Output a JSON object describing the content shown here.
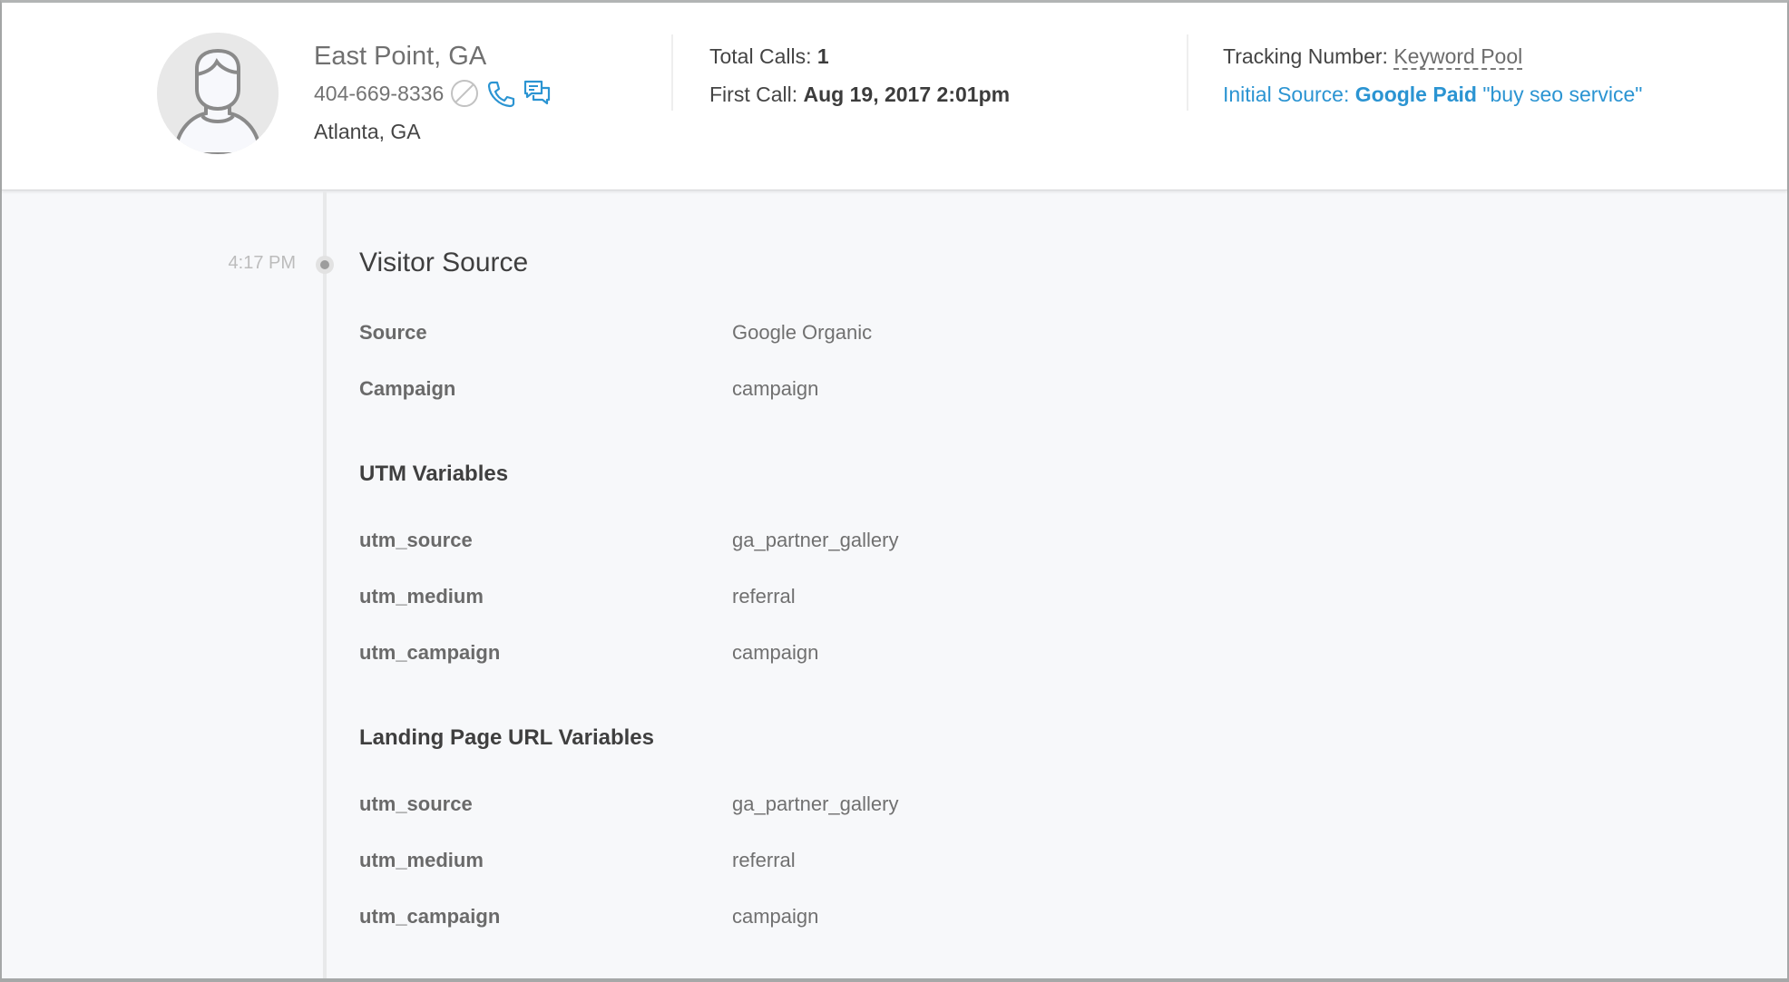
{
  "header": {
    "caller": {
      "city": "East Point, GA",
      "phone": "404-669-8336",
      "location": "Atlanta, GA",
      "icons": [
        "block-icon",
        "phone-icon",
        "chat-icon"
      ]
    },
    "stats": {
      "total_calls_label": "Total Calls:",
      "total_calls_value": "1",
      "first_call_label": "First Call:",
      "first_call_value": "Aug 19, 2017 2:01pm"
    },
    "tracking": {
      "tracking_label": "Tracking Number:",
      "tracking_value": "Keyword Pool",
      "initial_source_label": "Initial Source:",
      "initial_source_name": "Google Paid",
      "initial_source_keyword": "\"buy seo service\""
    }
  },
  "colors": {
    "accent": "#2b94d2",
    "background": "#f7f8fa",
    "header_bg": "#ffffff"
  },
  "timeline": {
    "time": "4:17 PM",
    "title": "Visitor Source",
    "fields": [
      {
        "label": "Source",
        "value": "Google Organic"
      },
      {
        "label": "Campaign",
        "value": "campaign"
      }
    ],
    "utm": {
      "heading": "UTM Variables",
      "rows": [
        {
          "label": "utm_source",
          "value": "ga_partner_gallery"
        },
        {
          "label": "utm_medium",
          "value": "referral"
        },
        {
          "label": "utm_campaign",
          "value": "campaign"
        }
      ]
    },
    "landing": {
      "heading": "Landing Page URL Variables",
      "rows": [
        {
          "label": "utm_source",
          "value": "ga_partner_gallery"
        },
        {
          "label": "utm_medium",
          "value": "referral"
        },
        {
          "label": "utm_campaign",
          "value": "campaign"
        }
      ]
    }
  }
}
